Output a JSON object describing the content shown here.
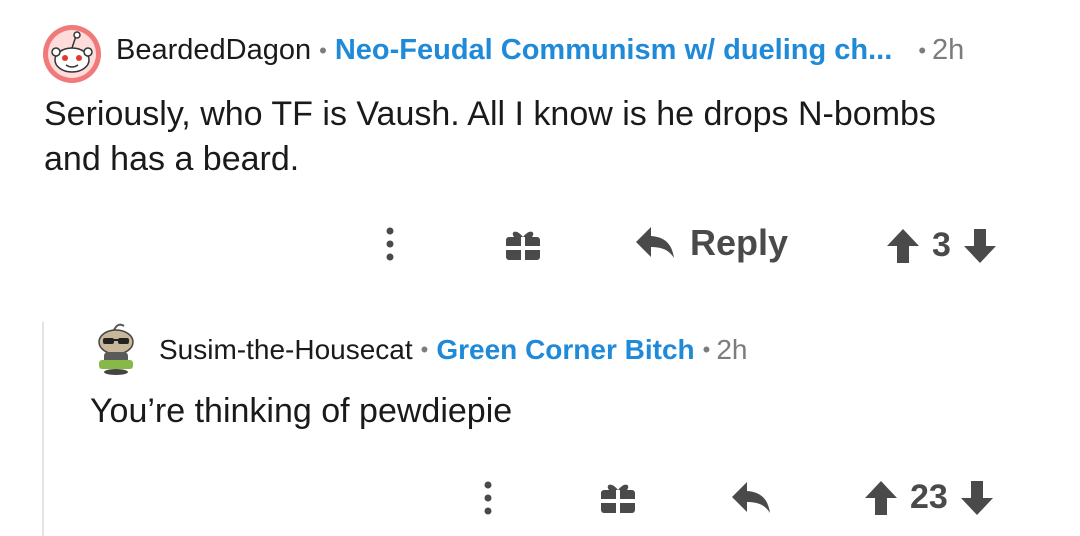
{
  "comments": [
    {
      "username": "BeardedDagon",
      "separator": "•",
      "flair": "Neo-Feudal Communism w/ dueling ch...",
      "age_separator": "•",
      "age": "2h",
      "body_line1": "Seriously, who TF is Vaush. All I know is he drops N-bombs",
      "body_line2": "and has a beard.",
      "reply_label": "Reply",
      "score": "3",
      "icons": [
        "avatar",
        "more-options-icon",
        "gift-icon",
        "reply-icon",
        "upvote-icon",
        "downvote-icon"
      ]
    },
    {
      "username": "Susim-the-Housecat",
      "separator": "•",
      "flair": "Green Corner Bitch",
      "age_separator": "•",
      "age": "2h",
      "body_line1": "You’re thinking of pewdiepie",
      "score": "23",
      "icons": [
        "avatar",
        "more-options-icon",
        "gift-icon",
        "reply-icon",
        "upvote-icon",
        "downvote-icon"
      ]
    }
  ],
  "colors": {
    "flair": "#1f8ad8",
    "avatar_red": "#ff4500",
    "icon_gray": "#4a4a4a",
    "thread_line": "#e4e4e4"
  }
}
